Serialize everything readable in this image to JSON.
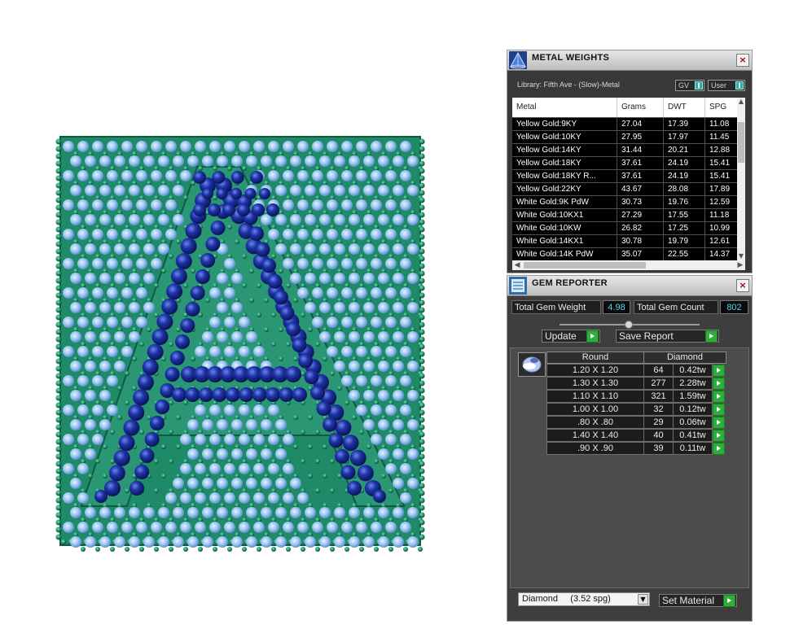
{
  "metal_weights": {
    "title": "METAL WEIGHTS",
    "close": "×",
    "library": "Library: Fifth Ave - (Slow)-Metal",
    "toggles": [
      {
        "label": "GV"
      },
      {
        "label": "User"
      }
    ],
    "columns": [
      "Metal",
      "Grams",
      "DWT",
      "SPG"
    ],
    "rows": [
      [
        "Yellow Gold:9KY",
        "27.04",
        "17.39",
        "11.08"
      ],
      [
        "Yellow Gold:10KY",
        "27.95",
        "17.97",
        "11.45"
      ],
      [
        "Yellow Gold:14KY",
        "31.44",
        "20.21",
        "12.88"
      ],
      [
        "Yellow Gold:18KY",
        "37.61",
        "24.19",
        "15.41"
      ],
      [
        "Yellow Gold:18KY R...",
        "37.61",
        "24.19",
        "15.41"
      ],
      [
        "Yellow Gold:22KY",
        "43.67",
        "28.08",
        "17.89"
      ],
      [
        "White Gold:9K PdW",
        "30.73",
        "19.76",
        "12.59"
      ],
      [
        "White Gold:10KX1",
        "27.29",
        "17.55",
        "11.18"
      ],
      [
        "White Gold:10KW",
        "26.82",
        "17.25",
        "10.99"
      ],
      [
        "White Gold:14KX1",
        "30.78",
        "19.79",
        "12.61"
      ],
      [
        "White Gold:14K PdW",
        "35.07",
        "22.55",
        "14.37"
      ]
    ]
  },
  "gem_reporter": {
    "title": "GEM REPORTER",
    "close": "×",
    "total_weight_label": "Total Gem Weight",
    "total_weight_value": "4.98",
    "total_count_label": "Total Gem Count",
    "total_count_value": "802",
    "update_label": "Update",
    "save_report_label": "Save Report",
    "table_headers": [
      "Round",
      "Diamond"
    ],
    "rows": [
      [
        "1.20 X 1.20",
        "64",
        "0.42tw"
      ],
      [
        "1.30 X 1.30",
        "277",
        "2.28tw"
      ],
      [
        "1.10 X 1.10",
        "321",
        "1.59tw"
      ],
      [
        "1.00 X 1.00",
        "32",
        "0.12tw"
      ],
      [
        ".80 X .80",
        "29",
        "0.06tw"
      ],
      [
        "1.40 X 1.40",
        "40",
        "0.41tw"
      ],
      [
        ".90 X .90",
        "39",
        "0.11tw"
      ]
    ],
    "material_select": "Diamond     (3.52 spg)",
    "set_material_label": "Set Material"
  },
  "colors": {
    "metal_green": "#1f8a68",
    "gem_light_blue": "#8fbff0",
    "gem_dark_blue": "#1b2f9e",
    "panel_bg": "#3c3c3c",
    "value_cyan": "#59d0e8",
    "arrow_green": "#2fae3c"
  },
  "icons": {
    "metal_panel_logo": "pyramid-logo-icon",
    "gem_panel_logo": "gem-list-icon",
    "gem_shape": "round-gem-icon"
  }
}
